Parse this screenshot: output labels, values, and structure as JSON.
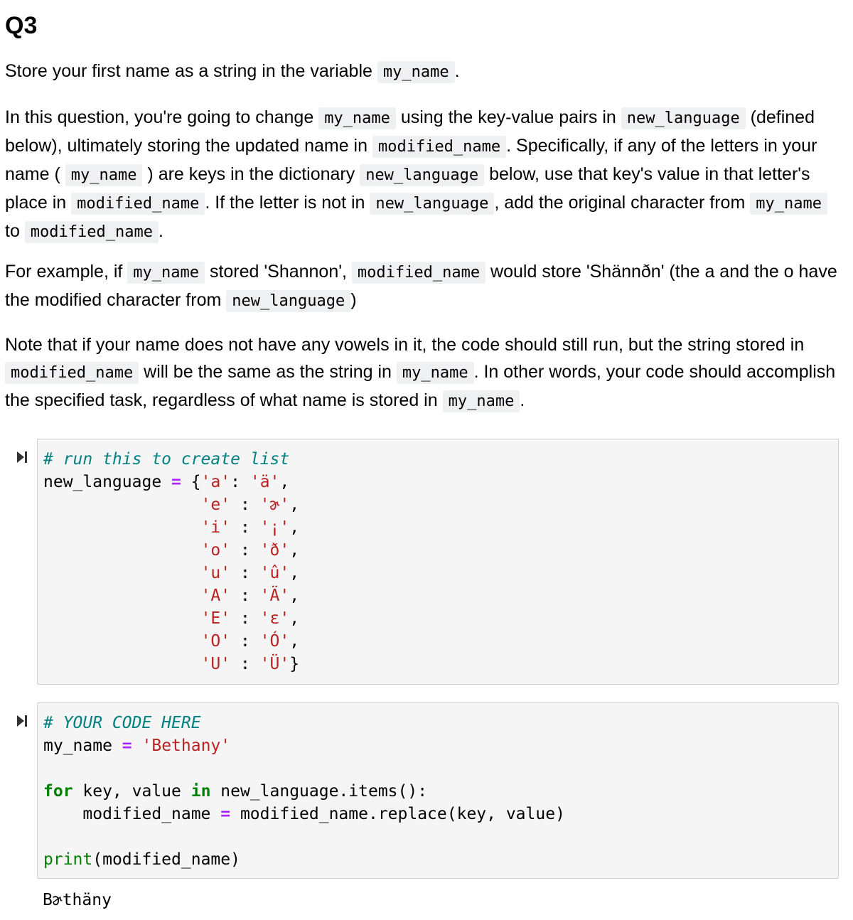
{
  "heading": "Q3",
  "para1": {
    "t1": "Store your first name as a string in the variable ",
    "c1": "my_name",
    "t2": "."
  },
  "para2": {
    "t1": "In this question, you're going to change ",
    "c1": "my_name",
    "t2": " using the key-value pairs in ",
    "c2": "new_language",
    "t3": " (defined below), ultimately storing the updated name in ",
    "c3": "modified_name",
    "t4": ". Specifically, if any of the letters in your name ( ",
    "c4": "my_name",
    "t5": " ) are keys in the dictionary ",
    "c5": "new_language",
    "t6": " below, use that key's value in that letter's place in ",
    "c6": "modified_name",
    "t7": ". If the letter is not in ",
    "c7": "new_language",
    "t8": ", add the original character from ",
    "c8": "my_name",
    "t9": " to ",
    "c9": "modified_name",
    "t10": "."
  },
  "para3": {
    "t1": "For example, if ",
    "c1": "my_name",
    "t2": " stored 'Shannon', ",
    "c2": "modified_name",
    "t3": " would store 'Shännðn' (the a and the o have the modified character from ",
    "c3": "new_language",
    "t4": ")"
  },
  "para4": {
    "t1": "Note that if your name does not have any vowels in it, the code should still run, but the string stored in ",
    "c1": "modified_name",
    "t2": " will be the same as the string in ",
    "c2": "my_name",
    "t3": ". In other words, your code should accomplish the specified task, regardless of what name is stored in ",
    "c3": "my_name",
    "t4": "."
  },
  "cell1": {
    "comment": "# run this to create list",
    "var": "new_language",
    "eq": "=",
    "pairs": [
      {
        "key": "'a'",
        "value": "'ä'"
      },
      {
        "key": "'e'",
        "value": "'ɚ'"
      },
      {
        "key": "'i'",
        "value": "'¡'"
      },
      {
        "key": "'o'",
        "value": "'ð'"
      },
      {
        "key": "'u'",
        "value": "'û'"
      },
      {
        "key": "'A'",
        "value": "'Ä'"
      },
      {
        "key": "'E'",
        "value": "'ɛ'"
      },
      {
        "key": "'O'",
        "value": "'Ó'"
      },
      {
        "key": "'U'",
        "value": "'Ü'"
      }
    ]
  },
  "cell2": {
    "comment": "# YOUR CODE HERE",
    "l1_var": "my_name ",
    "eq": "=",
    "l1_val": "'Bethany'",
    "for_kw": "for",
    "for_mid": " key, value ",
    "in_kw": "in",
    "for_end": " new_language.items():",
    "l4_a": "    modified_name ",
    "l4_b": " modified_name.replace(key, value)",
    "print_fn": "print",
    "print_args": "(modified_name)"
  },
  "output": "Bɚthäny"
}
